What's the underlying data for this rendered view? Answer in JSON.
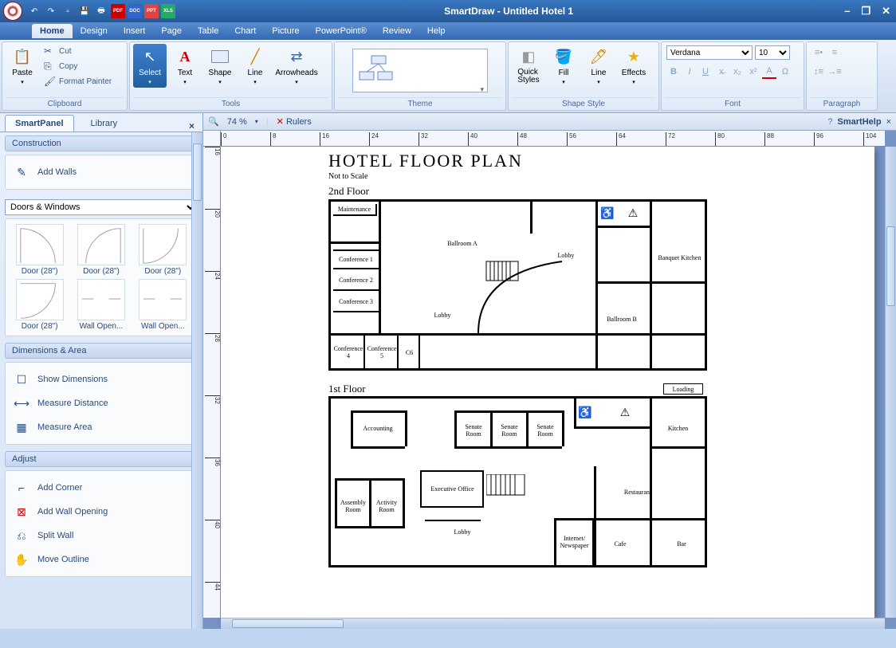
{
  "app": {
    "title": "SmartDraw - Untitled Hotel 1"
  },
  "menus": [
    "Home",
    "Design",
    "Insert",
    "Page",
    "Table",
    "Chart",
    "Picture",
    "PowerPoint®",
    "Review",
    "Help"
  ],
  "active_menu": 0,
  "ribbon": {
    "clipboard": {
      "label": "Clipboard",
      "paste": "Paste",
      "cut": "Cut",
      "copy": "Copy",
      "format_painter": "Format Painter"
    },
    "tools": {
      "label": "Tools",
      "select": "Select",
      "text": "Text",
      "shape": "Shape",
      "line": "Line",
      "arrowheads": "Arrowheads"
    },
    "theme": {
      "label": "Theme"
    },
    "shape_style": {
      "label": "Shape Style",
      "quick_styles": "Quick\nStyles",
      "fill": "Fill",
      "line": "Line",
      "effects": "Effects"
    },
    "font": {
      "label": "Font",
      "family": "Verdana",
      "size": "10"
    },
    "paragraph": {
      "label": "Paragraph"
    }
  },
  "secbar": {
    "zoom": "74 %",
    "rulers": "Rulers",
    "smarthelp": "SmartHelp"
  },
  "smartpanel": {
    "tabs": [
      "SmartPanel",
      "Library"
    ],
    "active_tab": 0,
    "section_construction": "Construction",
    "add_walls": "Add Walls",
    "dropdown": "Doors & Windows",
    "shapes": [
      "Door (28\")",
      "Door (28\")",
      "Door (28\")",
      "Door (28\")",
      "Wall Open...",
      "Wall Open..."
    ],
    "section_dimensions": "Dimensions & Area",
    "show_dimensions": "Show Dimensions",
    "measure_distance": "Measure Distance",
    "measure_area": "Measure Area",
    "section_adjust": "Adjust",
    "add_corner": "Add Corner",
    "add_wall_opening": "Add Wall Opening",
    "split_wall": "Split Wall",
    "move_outline": "Move Outline"
  },
  "ruler_ticks": [
    "0",
    "8",
    "16",
    "24",
    "32",
    "40",
    "48",
    "56",
    "64",
    "72",
    "80",
    "88",
    "96",
    "104"
  ],
  "ruler_v_ticks": [
    "16",
    "20",
    "24",
    "28",
    "32",
    "36",
    "40",
    "44"
  ],
  "document": {
    "title": "HOTEL FLOOR PLAN",
    "subtitle": "Not to Scale",
    "floor2_label": "2nd Floor",
    "floor1_label": "1st Floor",
    "floor2_rooms": [
      "Maintenance",
      "Ballroom A",
      "Lobby",
      "Conference 1",
      "Conference 2",
      "Conference 3",
      "Lobby",
      "Ballroom B",
      "Banquet Kitchen",
      "Conference 4",
      "Conference 5",
      "C6"
    ],
    "floor1_rooms": [
      "Loading",
      "Accounting",
      "Senate Room",
      "Senate Room",
      "Senate Room",
      "Kitchen",
      "Executive Office",
      "Assembly Room",
      "Activity Room",
      "Lobby",
      "Restaurant",
      "Internet/ Newspaper",
      "Cafe",
      "Bar"
    ]
  }
}
